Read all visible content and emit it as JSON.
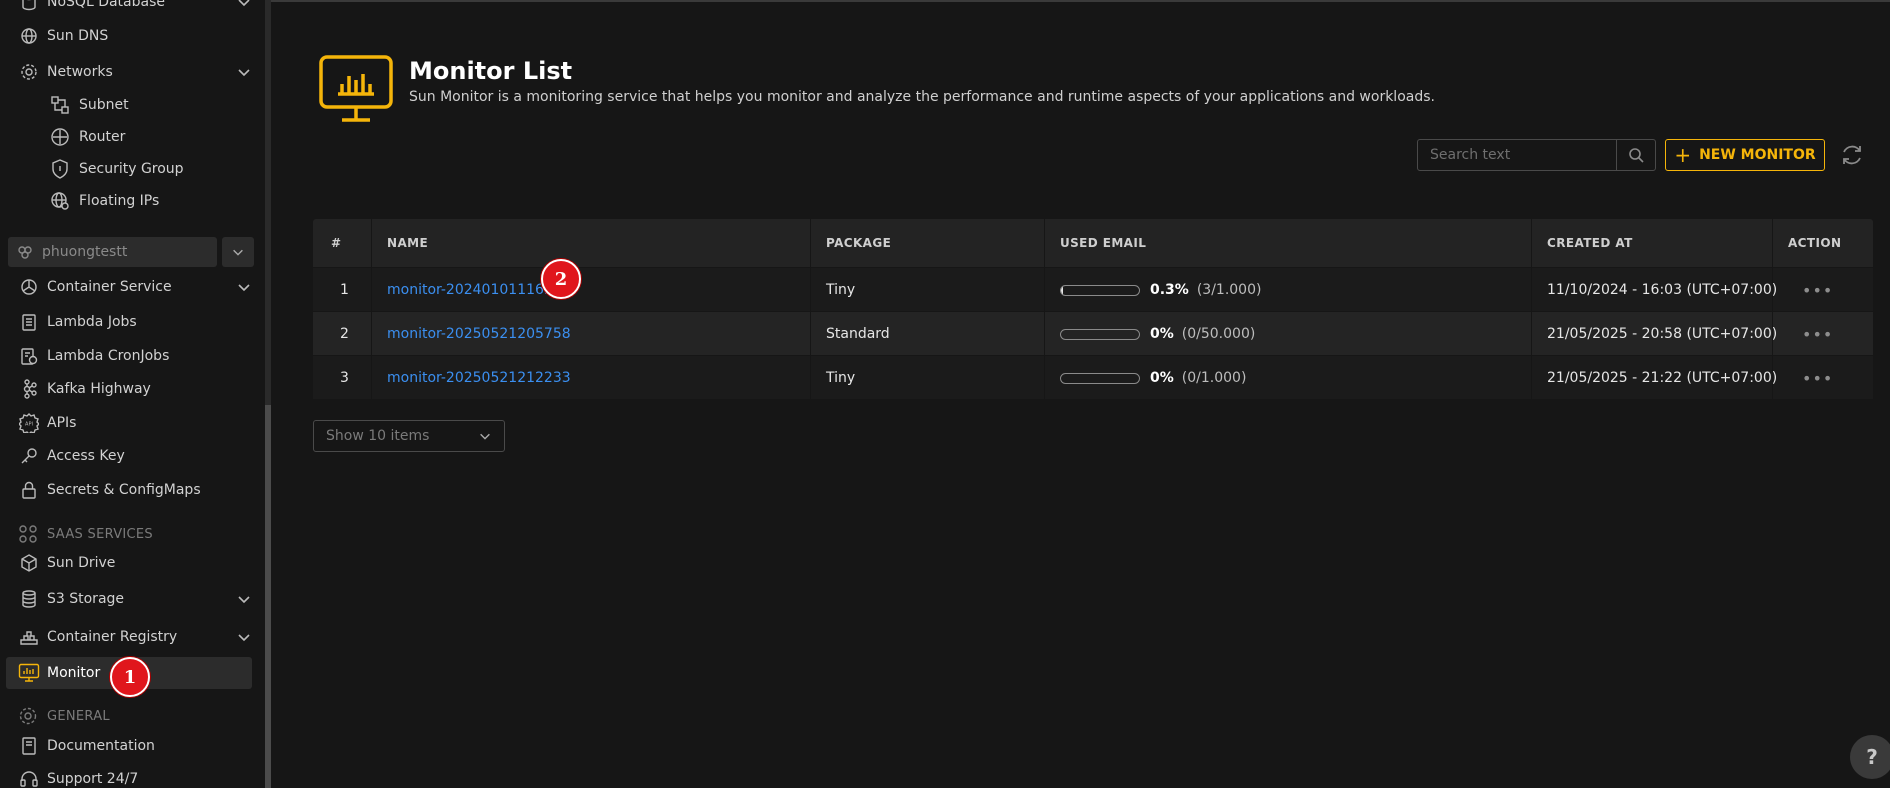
{
  "sidebar": {
    "items": [
      {
        "label": "NoSQL Database",
        "icon": "database-icon"
      },
      {
        "label": "Sun DNS",
        "icon": "globe-icon"
      },
      {
        "label": "Networks",
        "icon": "network-icon"
      },
      {
        "label": "Subnet",
        "icon": "subnet-icon"
      },
      {
        "label": "Router",
        "icon": "router-icon"
      },
      {
        "label": "Security Group",
        "icon": "shield-icon"
      },
      {
        "label": "Floating IPs",
        "icon": "floating-ip-icon"
      },
      {
        "label": "Container Service",
        "icon": "container-service-icon"
      },
      {
        "label": "Lambda Jobs",
        "icon": "clipboard-icon"
      },
      {
        "label": "Lambda CronJobs",
        "icon": "clipboard-clock-icon"
      },
      {
        "label": "Kafka Highway",
        "icon": "kafka-icon"
      },
      {
        "label": "APIs",
        "icon": "api-gear-icon"
      },
      {
        "label": "Access Key",
        "icon": "key-icon"
      },
      {
        "label": "Secrets & ConfigMaps",
        "icon": "lock-icon"
      },
      {
        "label": "Sun Drive",
        "icon": "cube-icon"
      },
      {
        "label": "S3 Storage",
        "icon": "storage-icon"
      },
      {
        "label": "Container Registry",
        "icon": "registry-icon"
      },
      {
        "label": "Monitor",
        "icon": "monitor-icon"
      },
      {
        "label": "Documentation",
        "icon": "book-icon"
      },
      {
        "label": "Support 24/7",
        "icon": "headset-icon"
      }
    ],
    "project": "phuongtestt",
    "sections": {
      "saas": "SAAS SERVICES",
      "general": "GENERAL"
    }
  },
  "header": {
    "title": "Monitor List",
    "description": "Sun Monitor is a monitoring service that helps you monitor and analyze the performance and runtime aspects of your applications and workloads."
  },
  "toolbar": {
    "search_placeholder": "Search text",
    "new_label": "NEW MONITOR"
  },
  "table": {
    "columns": [
      "#",
      "NAME",
      "PACKAGE",
      "USED EMAIL",
      "CREATED AT",
      "ACTION"
    ],
    "rows": [
      {
        "index": "1",
        "name": "monitor-2024010111636",
        "package": "Tiny",
        "used_pct": "0.3%",
        "used_fraction": 0.003,
        "used_count": "(3/1.000)",
        "created_at": "11/10/2024 - 16:03 (UTC+07:00)",
        "action": "•••"
      },
      {
        "index": "2",
        "name": "monitor-20250521205758",
        "package": "Standard",
        "used_pct": "0%",
        "used_fraction": 0,
        "used_count": "(0/50.000)",
        "created_at": "21/05/2025 - 20:58 (UTC+07:00)",
        "action": "•••"
      },
      {
        "index": "3",
        "name": "monitor-20250521212233",
        "package": "Tiny",
        "used_pct": "0%",
        "used_fraction": 0,
        "used_count": "(0/1.000)",
        "created_at": "21/05/2025 - 21:22 (UTC+07:00)",
        "action": "•••"
      }
    ]
  },
  "pagination": {
    "page_size_label": "Show 10 items"
  },
  "help": "?",
  "markers": [
    "1",
    "2"
  ],
  "colors": {
    "accent": "#f5b50a",
    "link": "#3b8ff0",
    "marker": "#e0161c"
  }
}
